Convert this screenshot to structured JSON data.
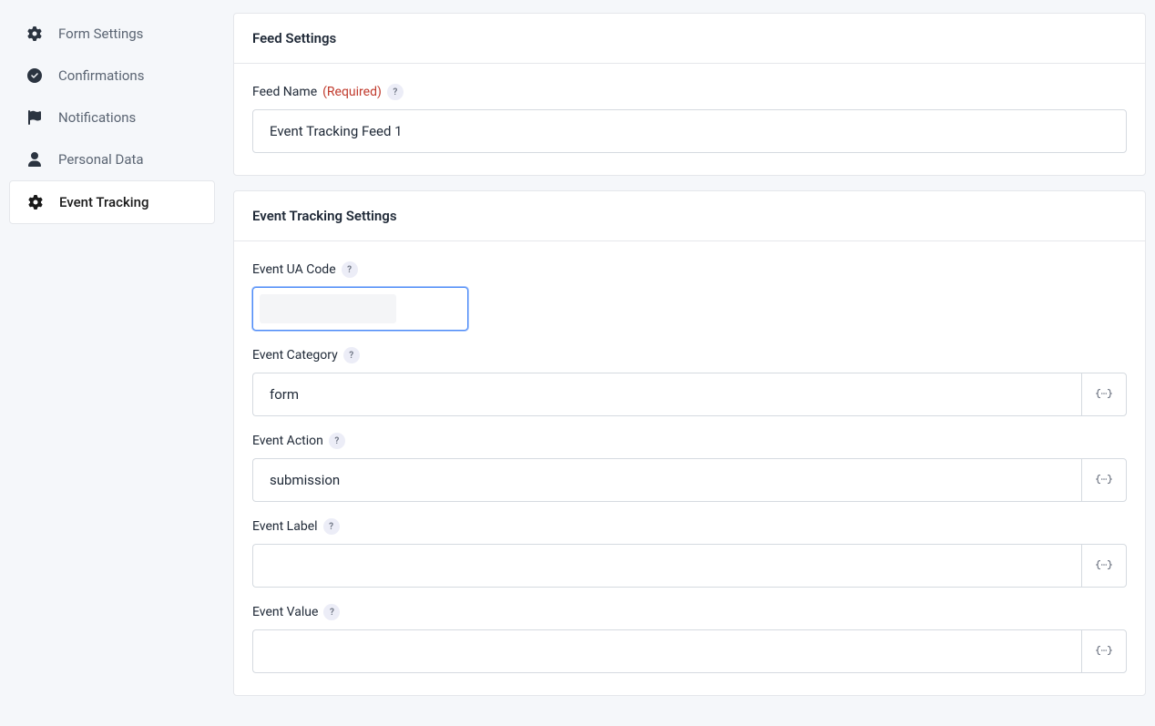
{
  "sidebar": {
    "items": [
      {
        "label": "Form Settings",
        "icon": "gear"
      },
      {
        "label": "Confirmations",
        "icon": "check-circle"
      },
      {
        "label": "Notifications",
        "icon": "flag"
      },
      {
        "label": "Personal Data",
        "icon": "user"
      },
      {
        "label": "Event Tracking",
        "icon": "gear"
      }
    ],
    "active_index": 4
  },
  "panels": {
    "feed": {
      "title": "Feed Settings",
      "fields": {
        "feed_name": {
          "label": "Feed Name",
          "required_text": "(Required)",
          "value": "Event Tracking Feed 1"
        }
      }
    },
    "event": {
      "title": "Event Tracking Settings",
      "fields": {
        "ua_code": {
          "label": "Event UA Code",
          "value": ""
        },
        "category": {
          "label": "Event Category",
          "value": "form"
        },
        "action": {
          "label": "Event Action",
          "value": "submission"
        },
        "elabel": {
          "label": "Event Label",
          "value": ""
        },
        "evalue": {
          "label": "Event Value",
          "value": ""
        }
      }
    }
  },
  "help_char": "?"
}
